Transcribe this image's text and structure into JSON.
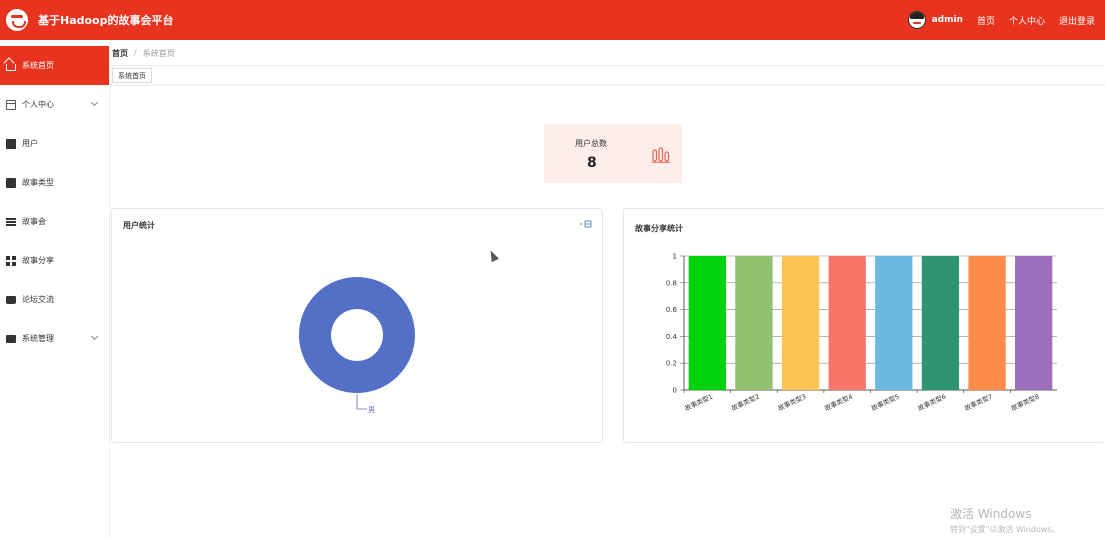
{
  "header": {
    "app_title": "基于Hadoop的故事会平台",
    "username": "admin",
    "links": [
      "首页",
      "个人中心",
      "退出登录"
    ]
  },
  "sidebar": {
    "items": [
      {
        "label": "系统首页",
        "icon": "home-icon",
        "active": true
      },
      {
        "label": "个人中心",
        "icon": "card-icon",
        "expandable": true
      },
      {
        "label": "用户",
        "icon": "chart-icon"
      },
      {
        "label": "故事类型",
        "icon": "clipboard-icon"
      },
      {
        "label": "故事会",
        "icon": "list-icon"
      },
      {
        "label": "故事分享",
        "icon": "grid-icon"
      },
      {
        "label": "论坛交流",
        "icon": "wallet-icon"
      },
      {
        "label": "系统管理",
        "icon": "monitor-icon",
        "expandable": true
      }
    ]
  },
  "breadcrumb": {
    "home": "首页",
    "separator": "/",
    "current": "系统首页"
  },
  "tabs": [
    {
      "label": "系统首页"
    }
  ],
  "stat": {
    "label": "用户总数",
    "value": "8"
  },
  "user_stats": {
    "title": "用户统计",
    "legend_label": "男",
    "chart_data": {
      "type": "pie",
      "categories": [
        "男"
      ],
      "values": [
        8
      ],
      "colors": [
        "#5470c6"
      ],
      "donut": true,
      "label_position": "bottom-outside"
    }
  },
  "story_stats": {
    "title": "故事分享统计",
    "chart_data": {
      "type": "bar",
      "categories": [
        "故事类型1",
        "故事类型2",
        "故事类型3",
        "故事类型4",
        "故事类型5",
        "故事类型6",
        "故事类型7",
        "故事类型8"
      ],
      "values": [
        1,
        1,
        1,
        1,
        1,
        1,
        1,
        1
      ],
      "colors": [
        "#00d20f",
        "#8fc16f",
        "#fdc453",
        "#f67769",
        "#6bb8e0",
        "#2f9472",
        "#fd8c4b",
        "#9c6ebc"
      ],
      "ylim": [
        0,
        1
      ],
      "yticks": [
        "0",
        "0.2",
        "0.4",
        "0.6",
        "0.8",
        "1"
      ],
      "grid": true,
      "xlabel_rotation": -25
    }
  },
  "watermark": {
    "line1": "激活 Windows",
    "line2": "转到\"设置\"以激活 Windows。"
  },
  "colors": {
    "primary": "#e8341f",
    "stat_bg": "#fdeeea"
  }
}
